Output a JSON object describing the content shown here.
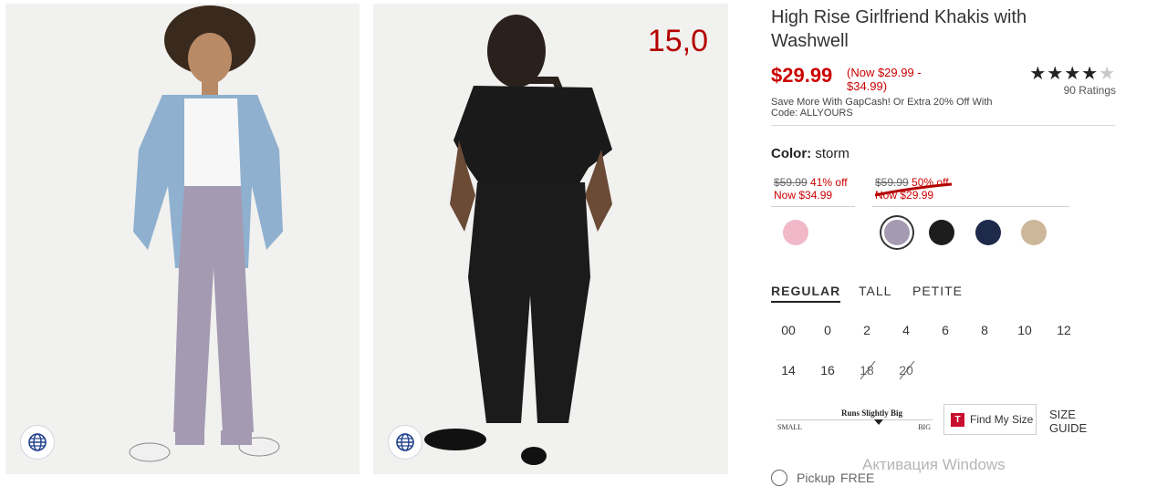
{
  "images": {
    "front_alt": "front view of woman wearing storm khakis with denim jacket",
    "back_alt": "back view of woman wearing black khakis",
    "overlay_number": "15,0",
    "rotate_icon": "360-view-icon"
  },
  "product": {
    "title": "High Rise Girlfriend Khakis with Washwell",
    "price": "$29.99",
    "price_range": "(Now $29.99 - $34.99)",
    "rating": {
      "stars": 4,
      "max": 5,
      "label": "90 Ratings"
    },
    "promo": "Save More With GapCash! Or Extra 20% Off With Code: ALLYOURS"
  },
  "color": {
    "label": "Color:",
    "value": "storm",
    "price_groups": [
      {
        "old": "$59.99",
        "off": "41% off",
        "now": "Now $34.99"
      },
      {
        "old": "$59.99",
        "off": "50% off",
        "now": "Now $29.99"
      }
    ],
    "swatches": [
      {
        "name": "pink",
        "hex": "#f0b8c8",
        "selected": false
      },
      {
        "name": "storm",
        "hex": "#a49ab2",
        "selected": true
      },
      {
        "name": "black",
        "hex": "#1d1d1d",
        "selected": false
      },
      {
        "name": "navy",
        "hex": "#1d2a4a",
        "selected": false
      },
      {
        "name": "khaki",
        "hex": "#ccb79a",
        "selected": false
      }
    ]
  },
  "fit_tabs": [
    "REGULAR",
    "TALL",
    "PETITE"
  ],
  "sizes": {
    "row1": [
      "00",
      "0",
      "2",
      "4",
      "6",
      "8",
      "10",
      "12"
    ],
    "row2": [
      "14",
      "16",
      "18",
      "20"
    ]
  },
  "fit_scale": {
    "label": "Runs Slightly Big",
    "small": "SMALL",
    "big": "BIG"
  },
  "find_my_size": {
    "icon": "T",
    "label": "Find My Size"
  },
  "size_guide": "SIZE GUIDE",
  "watermark": "Активация Windows",
  "pickup": {
    "label": "Pickup",
    "tag": "FREE"
  },
  "colors": {
    "sale_red": "#cc0000",
    "accent_red": "#b40000"
  }
}
